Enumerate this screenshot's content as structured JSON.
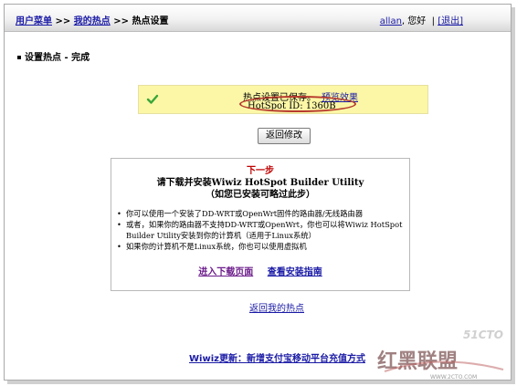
{
  "breadcrumb": {
    "item1": "用户菜单",
    "sep1": ">>",
    "item2": "我的热点",
    "sep2": ">>",
    "current": "热点设置"
  },
  "user": {
    "name": "allan",
    "greeting": ", 您好",
    "logout": "[退出]"
  },
  "section_title": "设置热点 - 完成",
  "notice": {
    "message": "热点设置已保存。",
    "preview_link": "预览效果",
    "hotspot_id": "HotSpot ID: 1360B"
  },
  "back_button": "返回修改",
  "next_step": {
    "label": "下一步",
    "heading": "请下载并安装Wiwiz HotSpot Builder Utility",
    "subheading": "（如您已安装可略过此步）",
    "bullets": [
      "你可以使用一个安装了DD-WRT或OpenWrt固件的路由器/无线路由器",
      "或者，如果你的路由器不支持DD-WRT或OpenWrt，你也可以将Wiwiz HotSpot Builder Utility安装到你的计算机（适用于Linux系统）",
      "如果你的计算机不是Linux系统，你也可以使用虚拟机"
    ],
    "download_link": "进入下载页面",
    "guide_link": "查看安装指南"
  },
  "return_link": "返回我的热点",
  "update_link": "Wiwiz更新：新增支付宝移动平台充值方式",
  "watermark": {
    "text1": "51CTO.com",
    "text2": "红黑联盟",
    "text3": "WWW.2CTO.COM"
  },
  "colors": {
    "link": "#1a1aa6",
    "next_step": "#c00000",
    "notice_bg": "#fbf7a6",
    "highlight_ellipse": "#b73a2e"
  }
}
